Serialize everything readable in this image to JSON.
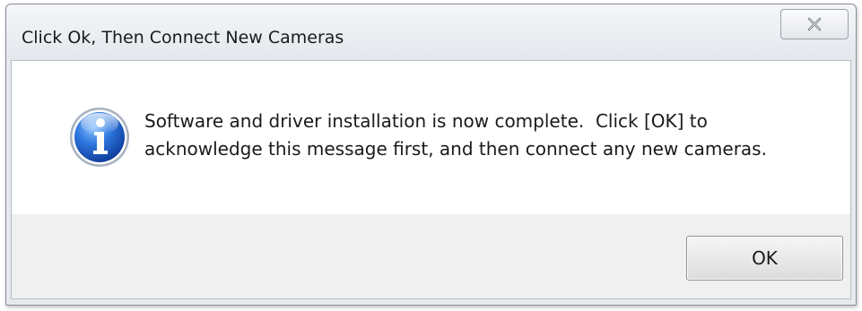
{
  "dialog": {
    "title": "Click Ok, Then Connect New Cameras",
    "close_icon": "close-icon",
    "message_icon": "information-icon",
    "message_line1": "Software and driver installation is now complete.  Click [OK] to",
    "message_line2": "acknowledge this message first, and then connect any new cameras.",
    "ok_label": "OK"
  },
  "colors": {
    "title_bar": "#e6e9ee",
    "info_icon_blue": "#1f5fc9",
    "message_area": "#ffffff",
    "button_bar": "#f0f0f0"
  }
}
